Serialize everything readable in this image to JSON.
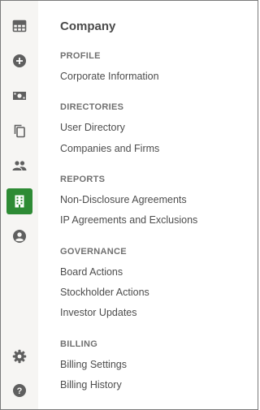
{
  "rail": {
    "items": [
      {
        "icon": "grid-table-icon",
        "active": false
      },
      {
        "icon": "add-circle-icon",
        "active": false
      },
      {
        "icon": "cash-icon",
        "active": false
      },
      {
        "icon": "copy-documents-icon",
        "active": false
      },
      {
        "icon": "people-icon",
        "active": false
      },
      {
        "icon": "building-icon",
        "active": true
      },
      {
        "icon": "account-circle-icon",
        "active": false
      }
    ],
    "bottom_items": [
      {
        "icon": "gear-icon"
      },
      {
        "icon": "help-icon"
      }
    ],
    "colors": {
      "icon": "#5f5f5f",
      "active_bg": "#2e8b35",
      "active_icon": "#ffffff"
    }
  },
  "panel": {
    "title": "Company",
    "sections": [
      {
        "heading": "PROFILE",
        "links": [
          "Corporate Information"
        ]
      },
      {
        "heading": "DIRECTORIES",
        "links": [
          "User Directory",
          "Companies and Firms"
        ]
      },
      {
        "heading": "REPORTS",
        "links": [
          "Non-Disclosure Agreements",
          "IP Agreements and Exclusions"
        ]
      },
      {
        "heading": "GOVERNANCE",
        "links": [
          "Board Actions",
          "Stockholder Actions",
          "Investor Updates"
        ]
      },
      {
        "heading": "BILLING",
        "links": [
          "Billing Settings",
          "Billing History"
        ]
      }
    ]
  }
}
